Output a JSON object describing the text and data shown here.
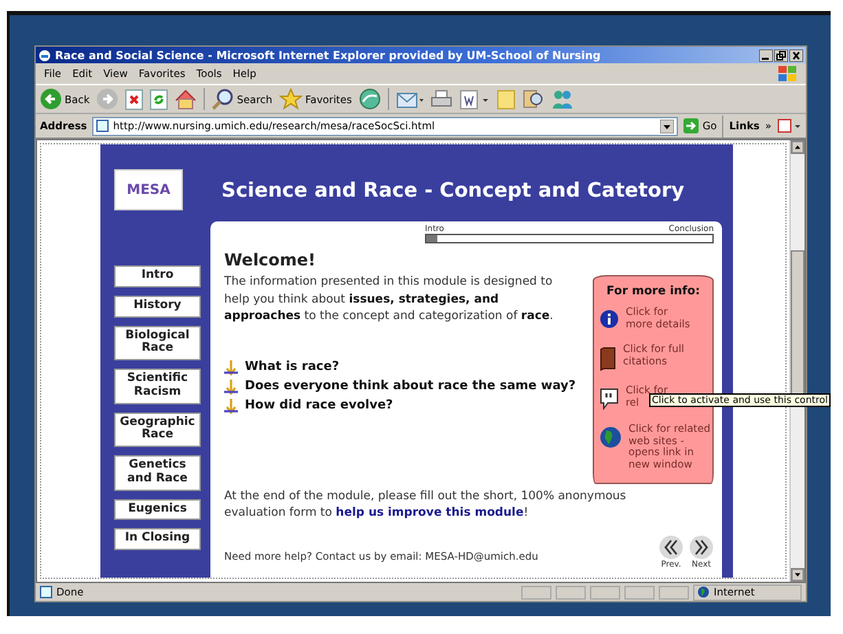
{
  "window": {
    "title": "Race and Social Science - Microsoft Internet Explorer provided by UM-School of Nursing"
  },
  "menu": [
    "File",
    "Edit",
    "View",
    "Favorites",
    "Tools",
    "Help"
  ],
  "toolbar": [
    {
      "kind": "back",
      "label": "Back"
    },
    {
      "kind": "forward"
    },
    {
      "kind": "stop"
    },
    {
      "kind": "refresh"
    },
    {
      "kind": "home"
    },
    {
      "kind": "search",
      "label": "Search"
    },
    {
      "kind": "favorites",
      "label": "Favorites"
    },
    {
      "kind": "media"
    },
    {
      "kind": "mail"
    },
    {
      "kind": "print"
    },
    {
      "kind": "edit"
    },
    {
      "kind": "notes"
    },
    {
      "kind": "research"
    },
    {
      "kind": "messenger"
    }
  ],
  "address": {
    "label": "Address",
    "url": "http://www.nursing.umich.edu/research/mesa/raceSocSci.html",
    "go": "Go",
    "links": "Links",
    "more": "»"
  },
  "page": {
    "logo": "MESA",
    "title": "Science and Race - Concept and Catetory",
    "nav": [
      "Intro",
      "History",
      "Biological Race",
      "Scientific Racism",
      "Geographic Race",
      "Genetics and Race",
      "Eugenics",
      "In Closing"
    ],
    "progress": {
      "start": "Intro",
      "end": "Conclusion",
      "level": 0.04
    },
    "heading": "Welcome!",
    "intro": "The information presented in this module is designed to help you think about **issues, strategies, and approaches** to the concept and categorization of **race**.",
    "questions": [
      "What is race?",
      "Does everyone think about race the same way?",
      "How did race evolve?"
    ],
    "info": {
      "title": "For more info:",
      "items": [
        {
          "kind": "info",
          "lines": [
            "Click for",
            "more details"
          ]
        },
        {
          "kind": "book",
          "lines": [
            "Click for full",
            "citations"
          ]
        },
        {
          "kind": "quote",
          "lines": [
            "Click for",
            "rel"
          ]
        },
        {
          "kind": "globe",
          "lines": [
            "Click for related",
            "web sites -",
            "opens link in",
            "new window"
          ]
        }
      ]
    },
    "tooltip": "Click to activate and use this control",
    "evaluation": {
      "before": "At the end of the module, please fill out the short, 100% anonymous evaluation form to ",
      "link": "help us improve this module",
      "after": "!"
    },
    "help": "Need more help? Contact us by email: MESA-HD@umich.edu",
    "pager": [
      {
        "kind": "prev",
        "label": "Prev."
      },
      {
        "kind": "next",
        "label": "Next"
      }
    ]
  },
  "status": {
    "text": "Done",
    "zone": "Internet"
  }
}
